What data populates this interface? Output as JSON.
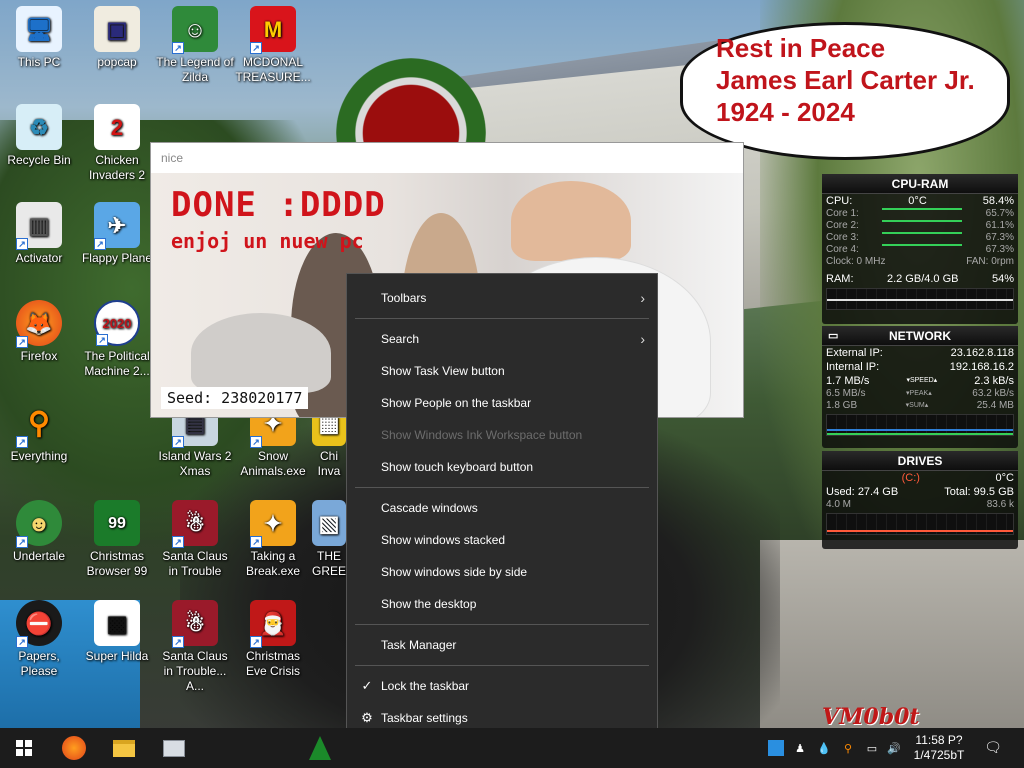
{
  "desktop_icons": [
    {
      "label": "This PC",
      "glyph": "🖥"
    },
    {
      "label": "popcap",
      "glyph": "▣"
    },
    {
      "label": "The Legend of Zilda",
      "glyph": "☺"
    },
    {
      "label": "MCDONAL TREASURE...",
      "glyph": "M"
    },
    {
      "label": "Recycle Bin",
      "glyph": "♻"
    },
    {
      "label": "Chicken Invaders 2",
      "glyph": "2"
    },
    {
      "label": "Activator",
      "glyph": "▥"
    },
    {
      "label": "Flappy Plane",
      "glyph": "✈"
    },
    {
      "label": "Firefox",
      "glyph": "🦊"
    },
    {
      "label": "The Political Machine 2...",
      "glyph": "2020"
    },
    {
      "label": "Everything",
      "glyph": "⚲"
    },
    {
      "label": "Island Wars 2 Xmas",
      "glyph": "▤"
    },
    {
      "label": "Snow Animals.exe",
      "glyph": "✦"
    },
    {
      "label": "Chi Inva",
      "glyph": "▦"
    },
    {
      "label": "Undertale",
      "glyph": "☻"
    },
    {
      "label": "Christmas Browser 99",
      "glyph": "99"
    },
    {
      "label": "Santa Claus in Trouble",
      "glyph": "☃"
    },
    {
      "label": "Taking a Break.exe",
      "glyph": "✦"
    },
    {
      "label": "THE GREE",
      "glyph": "▧"
    },
    {
      "label": "Papers, Please",
      "glyph": "⛔"
    },
    {
      "label": "Super Hilda",
      "glyph": "▩"
    },
    {
      "label": "Santa Claus in Trouble... A...",
      "glyph": "☃"
    },
    {
      "label": "Christmas Eve Crisis",
      "glyph": "🎅"
    }
  ],
  "bubble": {
    "line1": "Rest in Peace",
    "line2": "James Earl Carter Jr.",
    "line3": "1924 - 2024"
  },
  "nice_window": {
    "title": "nice",
    "headline": "DONE :DDDD",
    "subline": "enjoj un nuew pc",
    "seed": "Seed: 238020177"
  },
  "context_menu": {
    "items": [
      {
        "label": "Toolbars",
        "submenu": true
      },
      {
        "label": "Search",
        "submenu": true
      },
      {
        "label": "Show Task View button"
      },
      {
        "label": "Show People on the taskbar"
      },
      {
        "label": "Show Windows Ink Workspace button",
        "disabled": true
      },
      {
        "label": "Show touch keyboard button"
      },
      {
        "label": "Cascade windows"
      },
      {
        "label": "Show windows stacked"
      },
      {
        "label": "Show windows side by side"
      },
      {
        "label": "Show the desktop"
      },
      {
        "label": "Task Manager"
      },
      {
        "label": "Lock the taskbar",
        "checked": true
      },
      {
        "label": "Taskbar settings",
        "icon": "gear-icon"
      }
    ],
    "submenu_arrow": "›",
    "check_glyph": "✓",
    "gear_glyph": "⚙"
  },
  "gadgets": {
    "cpu": {
      "title": "CPU-RAM",
      "cpu_label": "CPU:",
      "temp": "0°C",
      "cpu_pct": "58.4%",
      "cores": [
        {
          "label": "Core 1:",
          "value": "65.7%"
        },
        {
          "label": "Core 2:",
          "value": "61.1%"
        },
        {
          "label": "Core 3:",
          "value": "67.3%"
        },
        {
          "label": "Core 4:",
          "value": "67.3%"
        }
      ],
      "clock_label": "Clock: 0 MHz",
      "fan_label": "FAN: 0rpm",
      "ram_label": "RAM:",
      "ram_value": "2.2 GB/4.0 GB",
      "ram_pct": "54%"
    },
    "network": {
      "title": "NETWORK",
      "ext_label": "External IP:",
      "ext_ip": "23.162.8.118",
      "int_label": "Internal IP:",
      "int_ip": "192.168.16.2",
      "rows": [
        {
          "left": "1.7 MB/s",
          "mid": "▾SPEED▴",
          "right": "2.3 kB/s"
        },
        {
          "left": "6.5 MB/s",
          "mid": "▾PEAK▴",
          "right": "63.2 kB/s"
        },
        {
          "left": "1.8 GB",
          "mid": "▾SUM▴",
          "right": "25.4 MB"
        }
      ]
    },
    "drives": {
      "title": "DRIVES",
      "drive": "(C:)",
      "temp": "0°C",
      "used_label": "Used:",
      "used": "27.4 GB",
      "total_label": "Total:",
      "total": "99.5 GB",
      "read": "4.0 M",
      "write": "83.6 k"
    }
  },
  "taskbar": {
    "clock_time": "11:58 P?",
    "clock_date": "1/4725bT"
  },
  "watermark": "VM0b0t",
  "colors": {
    "accent_red": "#c0141b",
    "menu_bg": "#2b2b2b",
    "taskbar_bg": "#1c1c1c"
  }
}
